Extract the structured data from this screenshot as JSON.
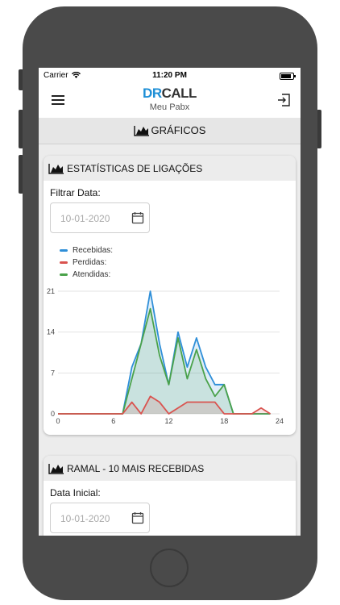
{
  "statusbar": {
    "carrier": "Carrier",
    "time": "11:20 PM"
  },
  "appbar": {
    "logo_dr": "DR",
    "logo_call": "CALL",
    "subtitle": "Meu Pabx"
  },
  "page": {
    "title": "GRÁFICOS"
  },
  "card1": {
    "title": "ESTATÍSTICAS DE LIGAÇÕES",
    "filter_label": "Filtrar Data:",
    "date_value": "10-01-2020"
  },
  "card2": {
    "title": "RAMAL - 10 MAIS RECEBIDAS",
    "filter_label": "Data Inicial:",
    "date_value": "10-01-2020"
  },
  "colors": {
    "recebidas": "#2f8fd8",
    "perdidas": "#d9534f",
    "atendidas": "#4aa24a",
    "brand": "#1e8fd6"
  },
  "chart_data": {
    "type": "line",
    "x": [
      0,
      1,
      2,
      3,
      4,
      5,
      6,
      7,
      8,
      9,
      10,
      11,
      12,
      13,
      14,
      15,
      16,
      17,
      18,
      19,
      20,
      21,
      22,
      23
    ],
    "xlim": [
      0,
      24
    ],
    "ylim": [
      0,
      21
    ],
    "xticks": [
      "0",
      "6",
      "12",
      "18",
      "24"
    ],
    "yticks": [
      "0",
      "7",
      "14",
      "21"
    ],
    "legend_position": "top-left",
    "grid": true,
    "series": [
      {
        "name": "Recebidas:",
        "values": [
          0,
          0,
          0,
          0,
          0,
          0,
          0,
          0,
          8,
          12,
          21,
          12,
          5,
          14,
          8,
          13,
          8,
          5,
          5,
          0,
          0,
          0,
          0,
          0
        ]
      },
      {
        "name": "Perdidas:",
        "values": [
          0,
          0,
          0,
          0,
          0,
          0,
          0,
          0,
          2,
          0,
          3,
          2,
          0,
          1,
          2,
          2,
          2,
          2,
          0,
          0,
          0,
          0,
          1,
          0
        ]
      },
      {
        "name": "Atendidas:",
        "values": [
          0,
          0,
          0,
          0,
          0,
          0,
          0,
          0,
          6,
          12,
          18,
          10,
          5,
          13,
          6,
          11,
          6,
          3,
          5,
          0,
          0,
          0,
          0,
          0
        ]
      }
    ]
  }
}
